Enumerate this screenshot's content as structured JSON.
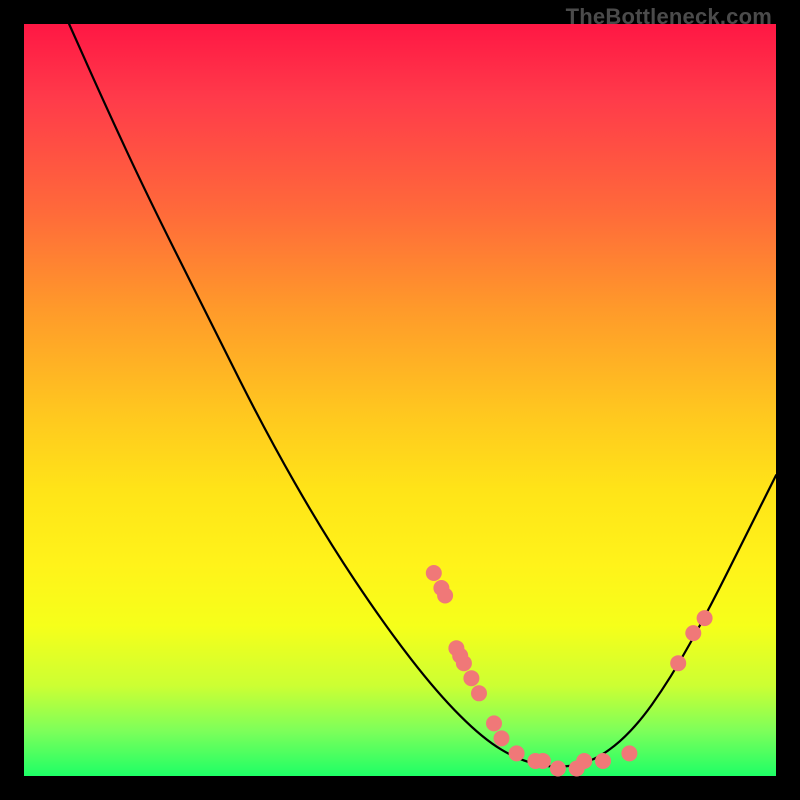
{
  "watermark": "TheBottleneck.com",
  "colors": {
    "curve": "#000000",
    "marker_fill": "#f07878",
    "marker_stroke": "#d85a5a",
    "gradient_top": "#ff1744",
    "gradient_bottom": "#1eff66",
    "frame_bg": "#000000"
  },
  "chart_data": {
    "type": "line",
    "title": "",
    "xlabel": "",
    "ylabel": "",
    "xlim": [
      0,
      100
    ],
    "ylim": [
      0,
      100
    ],
    "grid": false,
    "legend": false,
    "curve": [
      {
        "x": 6,
        "y": 100
      },
      {
        "x": 10,
        "y": 91
      },
      {
        "x": 16,
        "y": 78
      },
      {
        "x": 24,
        "y": 62
      },
      {
        "x": 32,
        "y": 46
      },
      {
        "x": 40,
        "y": 32
      },
      {
        "x": 48,
        "y": 20
      },
      {
        "x": 55,
        "y": 11
      },
      {
        "x": 61,
        "y": 5
      },
      {
        "x": 66,
        "y": 2
      },
      {
        "x": 71,
        "y": 1
      },
      {
        "x": 76,
        "y": 2
      },
      {
        "x": 81,
        "y": 6
      },
      {
        "x": 86,
        "y": 13
      },
      {
        "x": 91,
        "y": 22
      },
      {
        "x": 96,
        "y": 32
      },
      {
        "x": 100,
        "y": 40
      }
    ],
    "markers": [
      {
        "x": 54.5,
        "y": 27
      },
      {
        "x": 55.5,
        "y": 25
      },
      {
        "x": 56.0,
        "y": 24
      },
      {
        "x": 57.5,
        "y": 17
      },
      {
        "x": 58.0,
        "y": 16
      },
      {
        "x": 58.5,
        "y": 15
      },
      {
        "x": 59.5,
        "y": 13
      },
      {
        "x": 60.5,
        "y": 11
      },
      {
        "x": 62.5,
        "y": 7
      },
      {
        "x": 63.5,
        "y": 5
      },
      {
        "x": 65.5,
        "y": 3
      },
      {
        "x": 68.0,
        "y": 2
      },
      {
        "x": 69.0,
        "y": 2
      },
      {
        "x": 71.0,
        "y": 1
      },
      {
        "x": 73.5,
        "y": 1
      },
      {
        "x": 74.5,
        "y": 2
      },
      {
        "x": 77.0,
        "y": 2
      },
      {
        "x": 80.5,
        "y": 3
      },
      {
        "x": 87.0,
        "y": 15
      },
      {
        "x": 89.0,
        "y": 19
      },
      {
        "x": 90.5,
        "y": 21
      }
    ]
  }
}
